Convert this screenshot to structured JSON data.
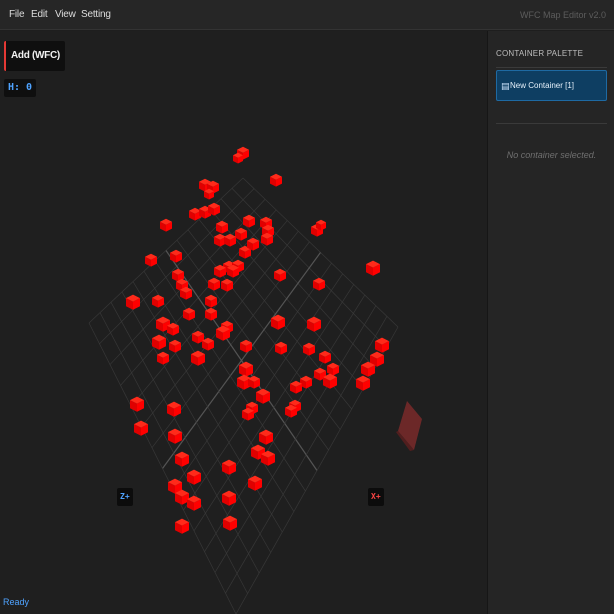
{
  "menu": {
    "items": [
      {
        "label": "File"
      },
      {
        "label": "Edit"
      },
      {
        "label": "View"
      },
      {
        "label": "Setting"
      }
    ],
    "app_title": "WFC Map Editor v2.0"
  },
  "viewport": {
    "mode_button": "Add (WFC)",
    "height_indicator": "H: 0",
    "axis_z_label": "Z+",
    "axis_x_label": "X+",
    "status": "Ready",
    "colors": {
      "block": "#ff0000",
      "grid": "#3a3a3a",
      "ghost": "#8b2a2a",
      "status": "#4fa3ff"
    }
  },
  "sidebar": {
    "palette_title": "CONTAINER PALETTE",
    "items": [
      {
        "label": "New Container [1]",
        "icon": "container-icon",
        "selected": true
      }
    ],
    "selection_status": "No container selected."
  }
}
